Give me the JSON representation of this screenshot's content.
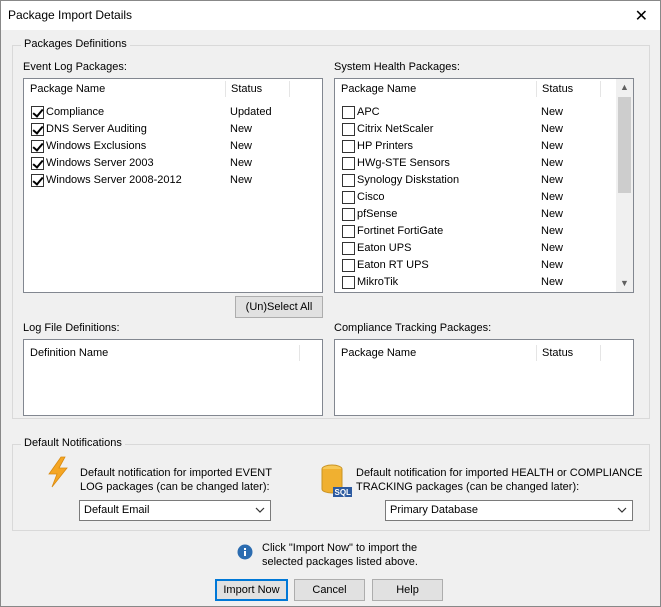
{
  "window": {
    "title": "Package Import Details"
  },
  "definitions": {
    "group_label": "Packages  Definitions",
    "event_log": {
      "label": "Event Log Packages:",
      "col_name": "Package Name",
      "col_status": "Status",
      "rows": [
        {
          "name": "Compliance",
          "status": "Updated",
          "checked": true
        },
        {
          "name": "DNS Server Auditing",
          "status": "New",
          "checked": true
        },
        {
          "name": "Windows Exclusions",
          "status": "New",
          "checked": true
        },
        {
          "name": "Windows Server 2003",
          "status": "New",
          "checked": true
        },
        {
          "name": "Windows Server 2008-2012",
          "status": "New",
          "checked": true
        }
      ]
    },
    "system_health": {
      "label": "System Health Packages:",
      "col_name": "Package Name",
      "col_status": "Status",
      "rows": [
        {
          "name": "APC",
          "status": "New",
          "checked": false
        },
        {
          "name": "Citrix NetScaler",
          "status": "New",
          "checked": false
        },
        {
          "name": "HP Printers",
          "status": "New",
          "checked": false
        },
        {
          "name": "HWg-STE Sensors",
          "status": "New",
          "checked": false
        },
        {
          "name": "Synology Diskstation",
          "status": "New",
          "checked": false
        },
        {
          "name": "Cisco",
          "status": "New",
          "checked": false
        },
        {
          "name": "pfSense",
          "status": "New",
          "checked": false
        },
        {
          "name": "Fortinet FortiGate",
          "status": "New",
          "checked": false
        },
        {
          "name": "Eaton UPS",
          "status": "New",
          "checked": false
        },
        {
          "name": "Eaton RT UPS",
          "status": "New",
          "checked": false
        },
        {
          "name": "MikroTik",
          "status": "New",
          "checked": false
        }
      ]
    },
    "select_all_label": "(Un)Select All",
    "log_file": {
      "label": "Log File Definitions:",
      "col_name": "Definition Name"
    },
    "compliance_tracking": {
      "label": "Compliance Tracking Packages:",
      "col_name": "Package Name",
      "col_status": "Status"
    }
  },
  "notifications": {
    "group_label": "Default Notifications",
    "event": {
      "icon": "lightning-icon",
      "text_line1": "Default notification for imported EVENT",
      "text_line2": "LOG packages (can be changed later):",
      "selected": "Default Email"
    },
    "health": {
      "icon": "sql-database-icon",
      "text_line1": "Default notification for imported HEALTH or COMPLIANCE",
      "text_line2": "TRACKING packages (can be changed later):",
      "selected": "Primary Database"
    }
  },
  "info": {
    "icon": "info-icon",
    "line1": "Click \"Import Now\" to import the",
    "line2": "selected packages listed above."
  },
  "buttons": {
    "import_now": "Import Now",
    "cancel": "Cancel",
    "help": "Help"
  },
  "colors": {
    "accent": "#0078d7",
    "lightning": "#f5a623",
    "database": "#f0b030",
    "info": "#2b6cb0"
  }
}
